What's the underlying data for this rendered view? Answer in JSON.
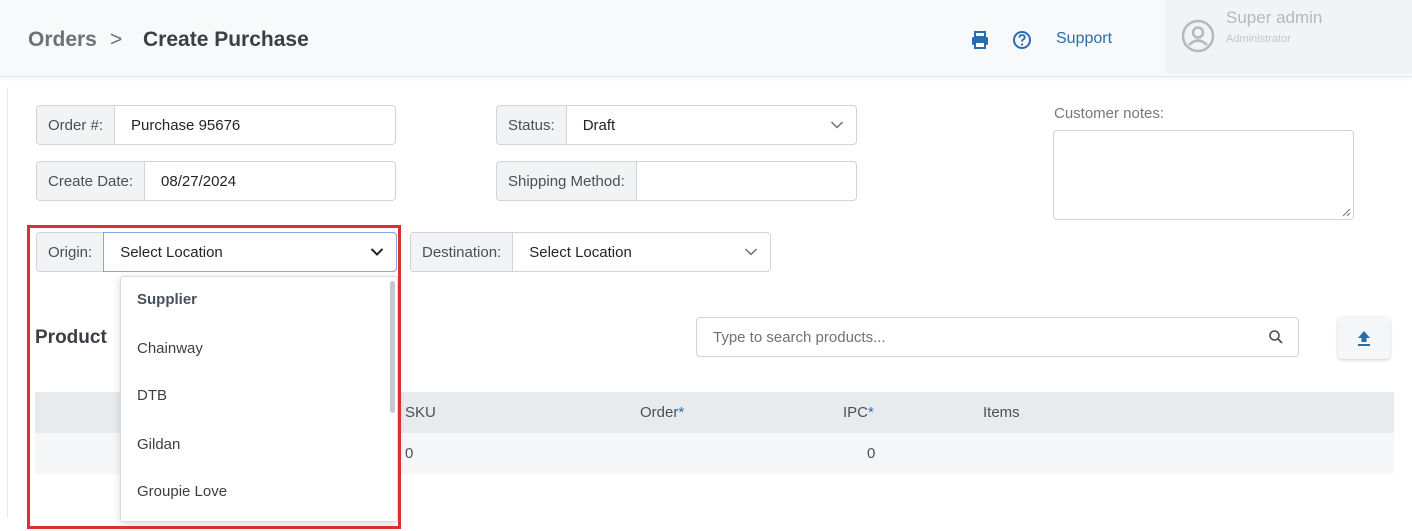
{
  "header": {
    "breadcrumb_root": "Orders",
    "breadcrumb_sep": ">",
    "breadcrumb_page": "Create Purchase",
    "print_icon": "printer-icon",
    "help_icon": "question-circle-icon",
    "support_label": "Support",
    "user_name": "Super admin",
    "user_role": "Administrator"
  },
  "form": {
    "order_label": "Order #:",
    "order_value": "Purchase 95676",
    "create_date_label": "Create Date:",
    "create_date_value": "08/27/2024",
    "status_label": "Status:",
    "status_value": "Draft",
    "shipping_label": "Shipping Method:",
    "shipping_value": "",
    "notes_label": "Customer notes:",
    "notes_value": "",
    "origin_label": "Origin:",
    "origin_value": "Select Location",
    "destination_label": "Destination:",
    "destination_value": "Select Location"
  },
  "dropdown": {
    "group_header": "Supplier",
    "options": [
      "Chainway",
      "DTB",
      "Gildan",
      "Groupie Love"
    ]
  },
  "products": {
    "title": "Product",
    "search_placeholder": "Type to search products...",
    "columns": {
      "sku": "SKU",
      "order": "Order",
      "ipc": "IPC",
      "items": "Items",
      "required_mark": "*"
    },
    "row": {
      "sku": "0",
      "ipc": "0"
    }
  },
  "colors": {
    "accent": "#2b6cb0",
    "highlight": "#d93030"
  }
}
